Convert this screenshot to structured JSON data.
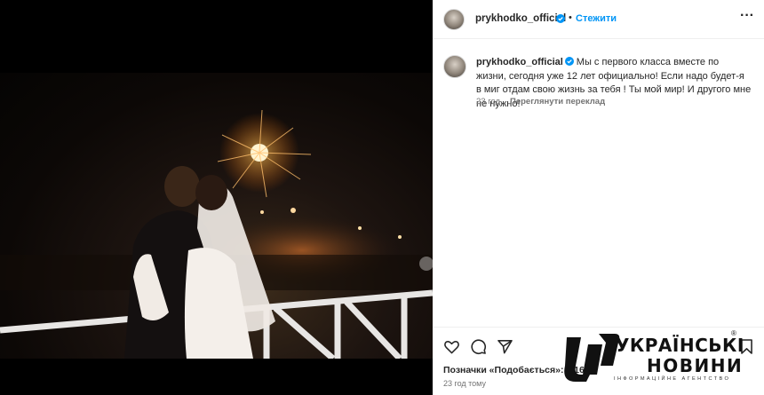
{
  "header": {
    "username": "prykhodko_official",
    "follow_label": "Стежити",
    "separator": "•",
    "more_label": "···"
  },
  "caption": {
    "username": "prykhodko_official",
    "text": "Мы с первого класса вместе по жизни, сегодня уже 12 лет официально! Если надо будет-я в миг отдам свою жизнь за тебя ! Ты мой мир! И другого мне не нужно!",
    "age": "23 год.",
    "translate_label": "Переглянути переклад"
  },
  "footer": {
    "likes_text": "Позначки «Подобається»: 2 164",
    "timestamp": "23 год тому"
  },
  "icons": {
    "verified": "verified-badge-icon",
    "like": "heart-icon",
    "comment": "comment-icon",
    "share": "send-icon",
    "save": "bookmark-icon"
  },
  "colors": {
    "accent": "#0095f6",
    "verified": "#0095f6",
    "muted": "#737373",
    "text": "#262626"
  },
  "watermark": {
    "line1": "УКРАЇНСЬКІ",
    "line2": "НОВИНИ",
    "subtitle": "ІНФОРМАЦІЙНЕ АГЕНТСТВО",
    "registered": "®"
  }
}
